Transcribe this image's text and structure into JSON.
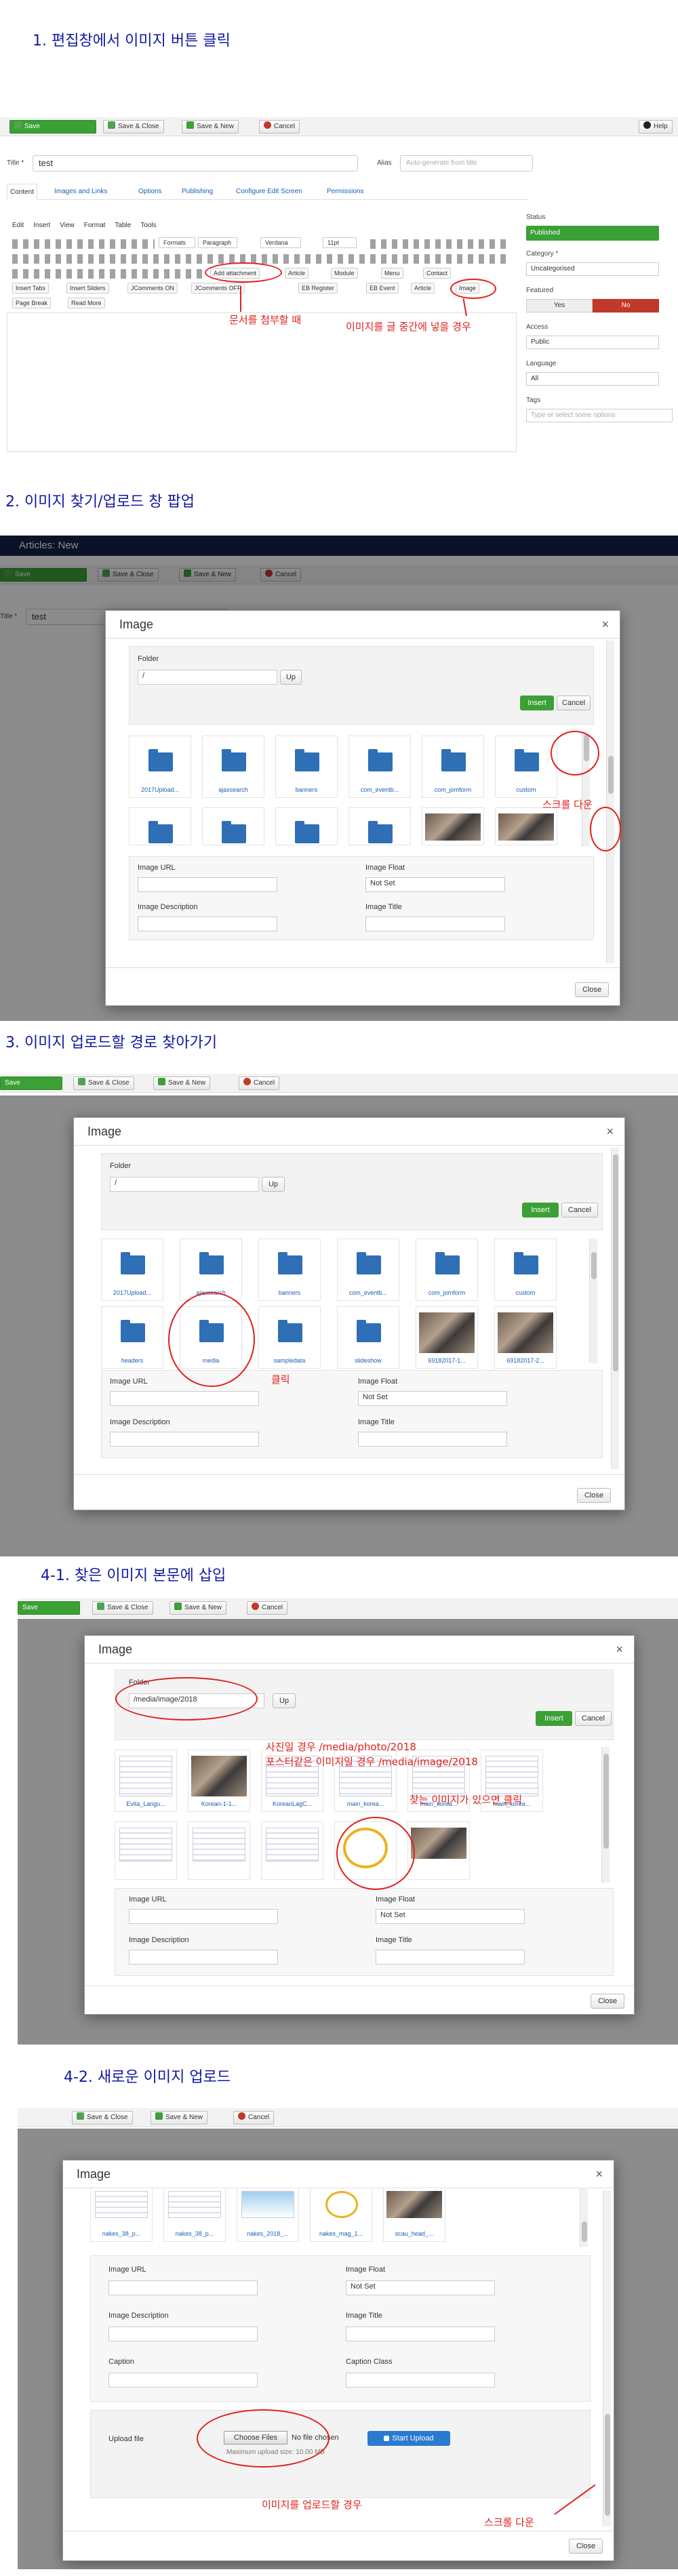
{
  "headings": {
    "h1": "1. 편집창에서 이미지 버튼 클릭",
    "h2": "2. 이미지 찾기/업로드 창 팝업",
    "h3": "3. 이미지 업로드할 경로 찾아가기",
    "h41": "4-1. 찾은 이미지 본문에 삽입",
    "h42": "4-2. 새로운 이미지 업로드"
  },
  "toolbar": {
    "save": "Save",
    "save_close": "Save & Close",
    "save_new": "Save & New",
    "cancel": "Cancel",
    "help": "Help"
  },
  "article": {
    "site_title": "Articles: New",
    "title_label": "Title *",
    "title_value": "test",
    "alias_label": "Alias",
    "alias_placeholder": "Auto-generate from title",
    "tabs": [
      "Content",
      "Images and Links",
      "Options",
      "Publishing",
      "Configure Edit Screen",
      "Permissions"
    ],
    "menus": [
      "Edit",
      "Insert",
      "View",
      "Format",
      "Table",
      "Tools"
    ],
    "format_values": [
      "Formats",
      "Paragraph",
      "Verdana",
      "11pt"
    ],
    "plugin_row1": [
      "Add attachment",
      "Article",
      "Module",
      "Menu",
      "Contact"
    ],
    "plugin_row2": [
      "Insert Tabs",
      "Insert Sliders",
      "JComments ON",
      "JComments OFF",
      "EB Register",
      "EB Event",
      "Article",
      "Image"
    ],
    "plugin_row3": [
      "Page Break",
      "Read More"
    ]
  },
  "sidebar": {
    "status_label": "Status",
    "status_value": "Published",
    "category_label": "Category *",
    "category_value": "Uncategorised",
    "featured_label": "Featured",
    "yes": "Yes",
    "no": "No",
    "access_label": "Access",
    "access_value": "Public",
    "language_label": "Language",
    "language_value": "All",
    "tags_label": "Tags",
    "tags_placeholder": "Type or select some options"
  },
  "annotations": {
    "s1_attach": "문서를 첨부할 때",
    "s1_image": "이미지를 글 중간에 넣을 경우",
    "s2_scroll": "스크롤 다운",
    "s3_click": "클릭",
    "s4_photo": "사진일 경우 /media/photo/2018",
    "s4_poster": "포스터같은 이미지일 경우 /media/image/2018",
    "s4_found": "찾는 이미지가 있으면 클릭",
    "s5_upload": "이미지를 업로드할 경우",
    "s5_scroll": "스크롤 다운"
  },
  "modal": {
    "title": "Image",
    "close_x": "×",
    "folder_label": "Folder",
    "folder_root": "/",
    "folder_path": "/media/image/2018",
    "up": "Up",
    "insert": "Insert",
    "cancel": "Cancel",
    "image_url": "Image URL",
    "image_float": "Image Float",
    "float_value": "Not Set",
    "image_description": "Image Description",
    "image_title": "Image Title",
    "caption": "Caption",
    "caption_class": "Caption Class",
    "upload_file": "Upload file",
    "choose_files": "Choose Files",
    "no_file": "No file chosen",
    "max_upload": "Maximum upload size: 10.00 MB",
    "start_upload": "Start Upload",
    "close_btn": "Close"
  },
  "folders": [
    "2017Upload...",
    "ajaxsearch",
    "banners",
    "com_eventb...",
    "com_jomform",
    "custom"
  ],
  "folders_row2": [
    "headers",
    "media",
    "sampledata",
    "slideshow",
    "69182017-1...",
    "69182017-2..."
  ],
  "images_s4": [
    "Evita_Langu...",
    "Korean-1-1...",
    "KoreanLagC...",
    "main_korea...",
    "main_korea...",
    "main_korea..."
  ],
  "images_s5": [
    "nakes_38_p...",
    "nakes_38_p...",
    "nakes_2018_...",
    "nakes_mag_1...",
    "scau_head_..."
  ]
}
